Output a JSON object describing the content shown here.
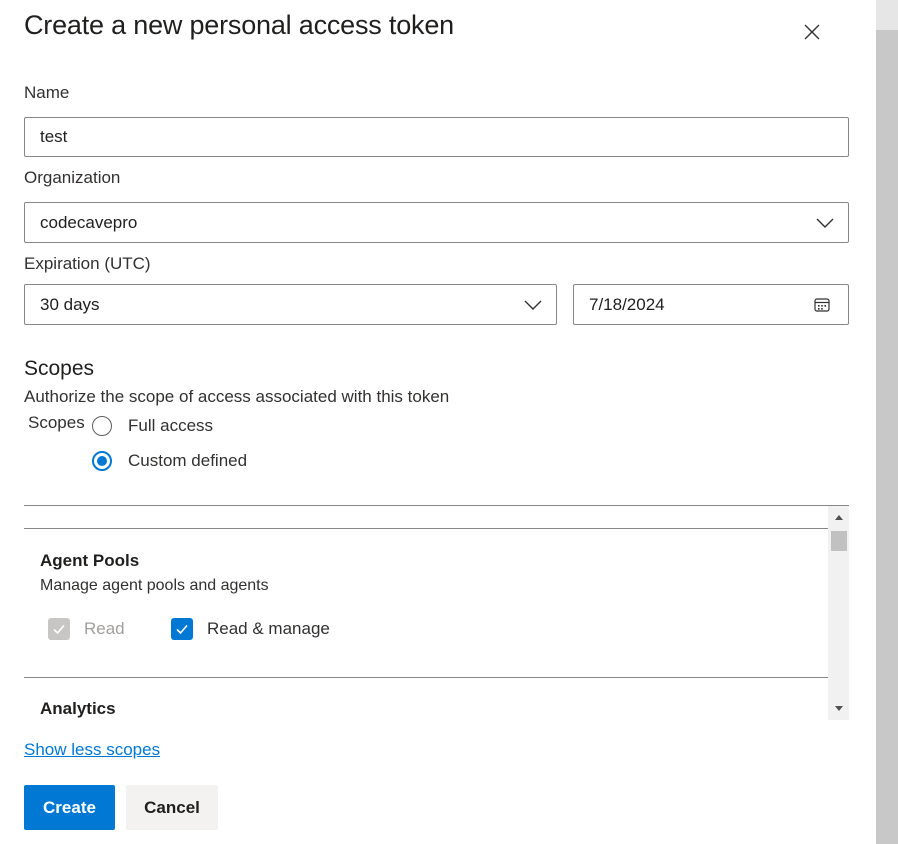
{
  "dialog": {
    "title": "Create a new personal access token",
    "close_icon": "close-icon"
  },
  "form": {
    "name": {
      "label": "Name",
      "value": "test"
    },
    "organization": {
      "label": "Organization",
      "value": "codecavepro",
      "icon": "chevron-down-icon"
    },
    "expiration": {
      "label": "Expiration (UTC)",
      "duration_value": "30 days",
      "duration_icon": "chevron-down-icon",
      "date_value": "7/18/2024",
      "date_icon": "calendar-icon"
    }
  },
  "scopes": {
    "heading": "Scopes",
    "description": "Authorize the scope of access associated with this token",
    "group_label": "Scopes",
    "options": [
      {
        "label": "Full access",
        "selected": false
      },
      {
        "label": "Custom defined",
        "selected": true
      }
    ],
    "list": [
      {
        "name": "Agent Pools",
        "description": "Manage agent pools and agents",
        "permissions": [
          {
            "label": "Read",
            "checked": true,
            "disabled": true
          },
          {
            "label": "Read & manage",
            "checked": true,
            "disabled": false
          }
        ]
      },
      {
        "name": "Analytics"
      }
    ],
    "toggle_link": "Show less scopes"
  },
  "actions": {
    "create_label": "Create",
    "cancel_label": "Cancel"
  },
  "colors": {
    "accent": "#0078d4",
    "border": "#8a8886",
    "disabled": "#c8c6c4"
  }
}
